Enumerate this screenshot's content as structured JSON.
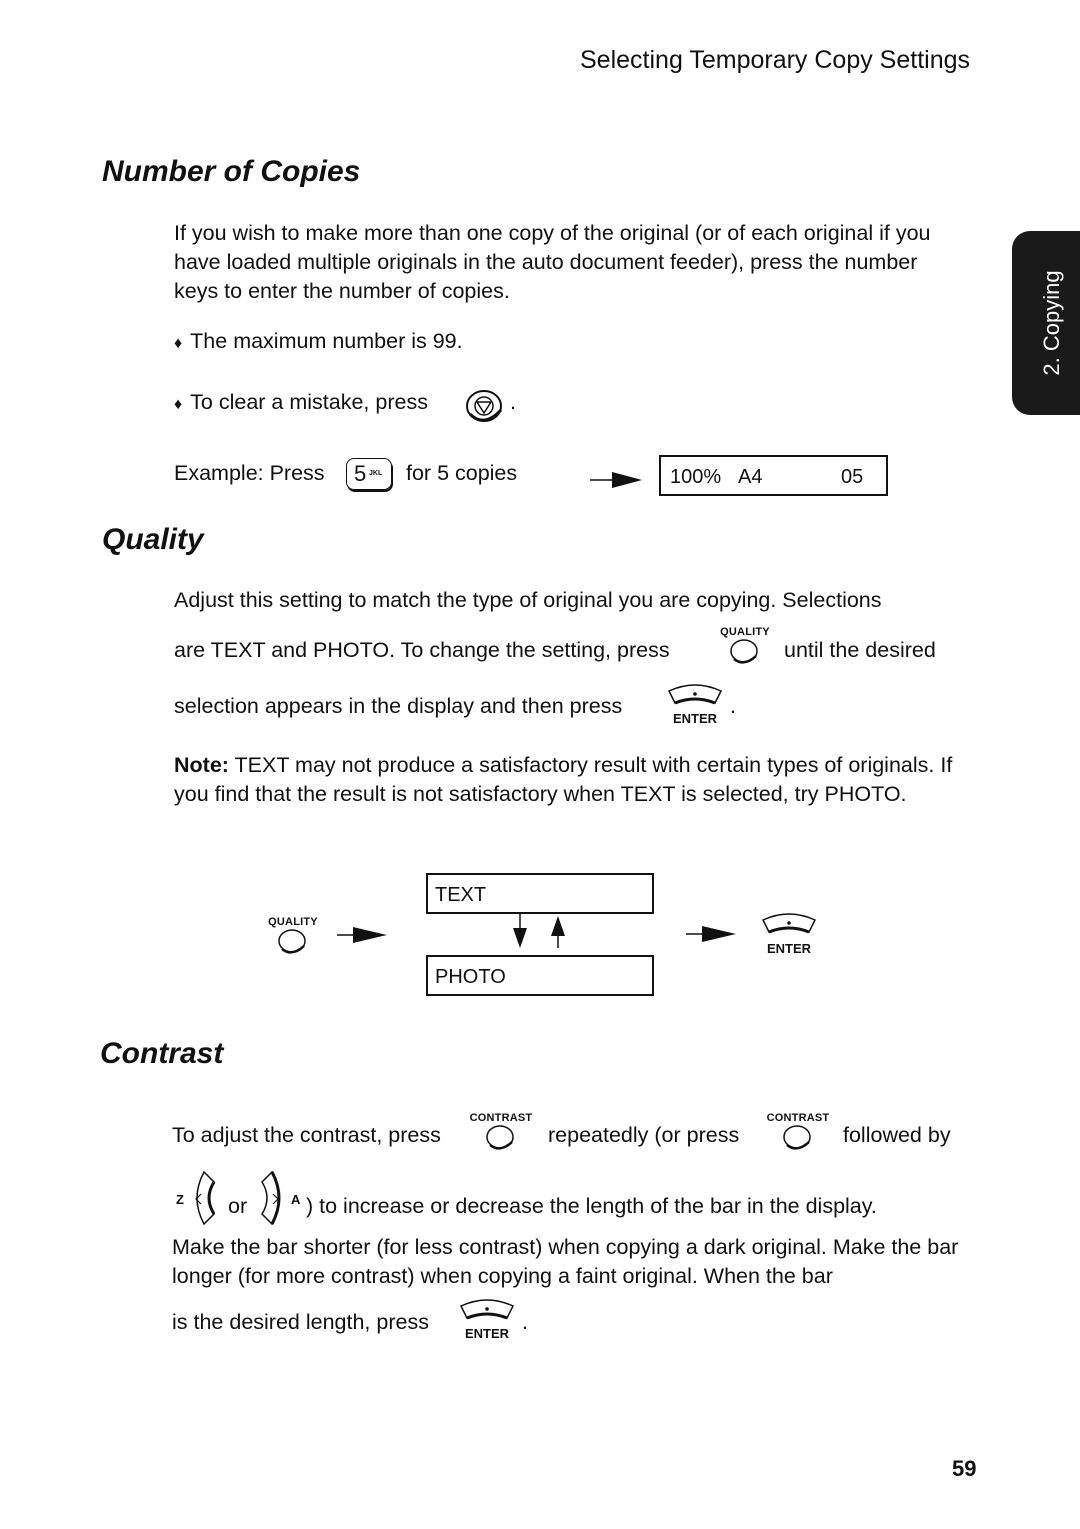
{
  "header": {
    "running_title": "Selecting Temporary Copy Settings"
  },
  "side_tab": {
    "label": "2. Copying"
  },
  "sections": {
    "copies": {
      "title": "Number of Copies",
      "intro": "If you wish to make more than one copy of the original (or of each original if you have loaded multiple originals in the auto document feeder), press the number keys to enter the number of copies.",
      "bullet_1": "The maximum number is 99.",
      "bullet_2_prefix": "To clear a mistake, press",
      "bullet_2_suffix": ".",
      "example_prefix": "Example: Press",
      "example_key_digit": "5",
      "example_key_letters": "JKL",
      "example_suffix": "for 5 copies",
      "display": {
        "zoom": "100%",
        "paper": "A4",
        "count": "05"
      }
    },
    "quality": {
      "title": "Quality",
      "line_1": "Adjust this setting to match the type of original you are copying. Selections",
      "line_2_prefix": "are TEXT and PHOTO. To change the setting, press",
      "line_2_suffix": "until the desired",
      "line_3_prefix": "selection appears in the display and then press",
      "line_3_suffix": ".",
      "note_label": "Note:",
      "note_text": " TEXT may not produce a satisfactory result with certain types of originals. If you find that the result is not satisfactory when TEXT is selected, try PHOTO.",
      "diagram": {
        "option_1": "TEXT",
        "option_2": "PHOTO"
      }
    },
    "contrast": {
      "title": "Contrast",
      "line_1_prefix": "To adjust the contrast, press",
      "line_1_mid": "repeatedly (or press",
      "line_1_suffix": "followed by",
      "line_2_or": "or",
      "line_2_suffix": ") to increase or decrease the length of the bar in the display.",
      "para": "Make the bar shorter (for less contrast) when copying a dark original. Make the bar longer (for more contrast) when copying a faint original. When the bar",
      "last_prefix": "is the desired length, press",
      "last_suffix": "."
    }
  },
  "keys": {
    "quality": "QUALITY",
    "contrast": "CONTRAST",
    "enter": "ENTER",
    "left_letter": "Z",
    "right_letter": "A"
  },
  "bullet_glyph": "♦",
  "page_number": "59"
}
